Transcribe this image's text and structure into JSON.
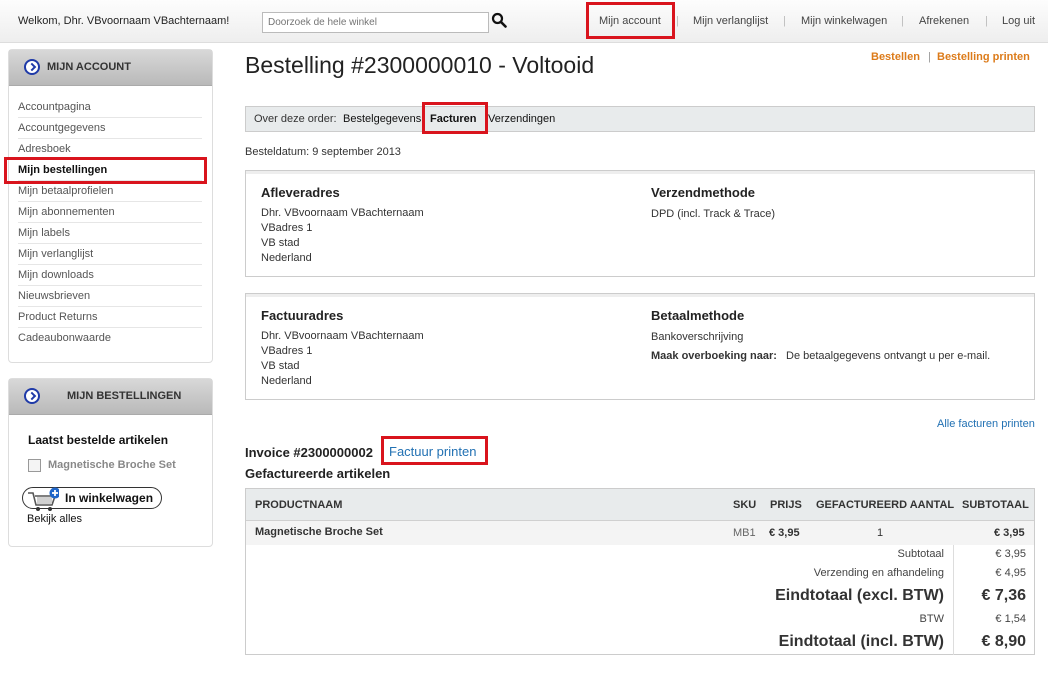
{
  "header": {
    "welcome": "Welkom, Dhr. VBvoornaam VBachternaam!",
    "search_placeholder": "Doorzoek de hele winkel",
    "links": [
      "Mijn account",
      "Mijn verlanglijst",
      "Mijn winkelwagen",
      "Afrekenen",
      "Log uit"
    ]
  },
  "sidebar": {
    "account_title": "MIJN ACCOUNT",
    "items": [
      "Accountpagina",
      "Accountgegevens",
      "Adresboek",
      "Mijn bestellingen",
      "Mijn betaalprofielen",
      "Mijn abonnementen",
      "Mijn labels",
      "Mijn verlanglijst",
      "Mijn downloads",
      "Nieuwsbrieven",
      "Product Returns",
      "Cadeaubonwaarde"
    ],
    "orders_title": "MIJN BESTELLINGEN",
    "last_ordered": "Laatst bestelde artikelen",
    "last_item": "Magnetische Broche Set",
    "cart_button": "In winkelwagen",
    "view_all": "Bekijk alles"
  },
  "order": {
    "title": "Bestelling #2300000010 - Voltooid",
    "action_order": "Bestellen",
    "action_sep": "|",
    "action_print": "Bestelling printen",
    "about_label": "Over deze order:",
    "tabs": [
      "Bestelgegevens",
      "Facturen",
      "Verzendingen"
    ],
    "date": "Besteldatum: 9 september 2013",
    "shipping_address": {
      "heading": "Afleveradres",
      "lines": [
        "Dhr. VBvoornaam VBachternaam",
        "VBadres 1",
        "VB stad",
        "Nederland"
      ]
    },
    "shipping_method": {
      "heading": "Verzendmethode",
      "value": "DPD (incl. Track & Trace)"
    },
    "billing_address": {
      "heading": "Factuuradres",
      "lines": [
        "Dhr. VBvoornaam VBachternaam",
        "VBadres 1",
        "VB stad",
        "Nederland"
      ]
    },
    "payment_method": {
      "heading": "Betaalmethode",
      "value": "Bankoverschrijving",
      "transfer_label": "Maak overboeking naar:",
      "transfer_text": "De betaalgegevens ontvangt u per e-mail."
    }
  },
  "invoice": {
    "print_all": "Alle facturen printen",
    "title": "Invoice #2300000002",
    "print": "Factuur printen",
    "items_title": "Gefactureerde artikelen",
    "columns": [
      "PRODUCTNAAM",
      "SKU",
      "PRIJS",
      "GEFACTUREERD AANTAL",
      "SUBTOTAAL"
    ],
    "rows": [
      {
        "name": "Magnetische Broche Set",
        "sku": "MB1",
        "price": "€ 3,95",
        "qty": "1",
        "subtotal": "€ 3,95"
      }
    ],
    "totals": [
      {
        "label": "Subtotaal",
        "value": "€ 3,95"
      },
      {
        "label": "Verzending en afhandeling",
        "value": "€ 4,95"
      },
      {
        "label": "Eindtotaal (excl. BTW)",
        "value": "€ 7,36"
      },
      {
        "label": "BTW",
        "value": "€ 1,54"
      },
      {
        "label": "Eindtotaal (incl. BTW)",
        "value": "€ 8,90"
      }
    ]
  },
  "colors": {
    "highlight": "#d9141d",
    "link": "#2271b3",
    "action": "#dc7b1a"
  }
}
